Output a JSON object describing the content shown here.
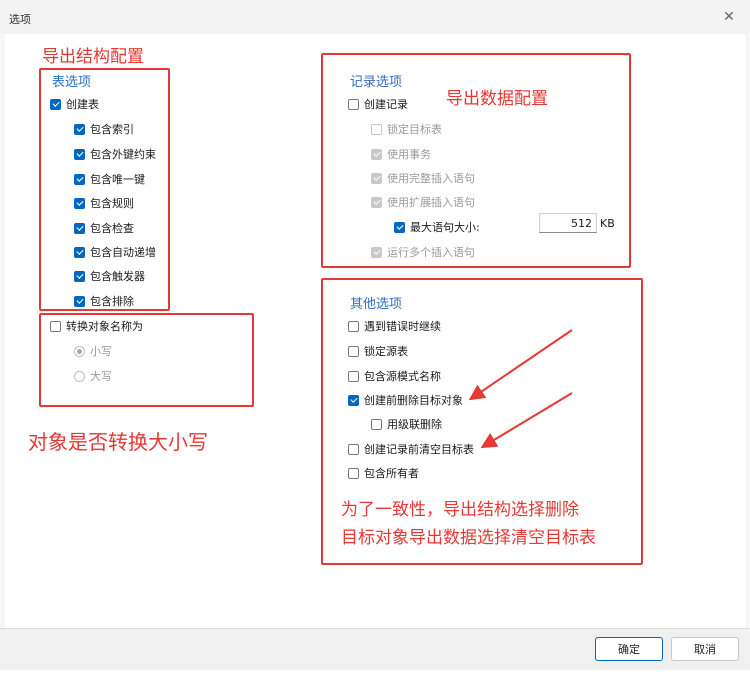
{
  "window": {
    "title": "选项"
  },
  "table_options": {
    "title": "表选项",
    "create_table": "创建表",
    "items": [
      {
        "label": "包含索引"
      },
      {
        "label": "包含外键约束"
      },
      {
        "label": "包含唯一键"
      },
      {
        "label": "包含规则"
      },
      {
        "label": "包含检查"
      },
      {
        "label": "包含自动递增"
      },
      {
        "label": "包含触发器"
      },
      {
        "label": "包含排除"
      }
    ]
  },
  "convert": {
    "label": "转换对象名称为",
    "lower": "小写",
    "upper": "大写"
  },
  "record_options": {
    "title": "记录选项",
    "create_record": "创建记录",
    "lock_target": "锁定目标表",
    "use_transaction": "使用事务",
    "use_complete_insert": "使用完整插入语句",
    "use_extended_insert": "使用扩展插入语句",
    "max_statement": "最大语句大小:",
    "max_value": "512",
    "max_unit": "KB",
    "run_multiple": "运行多个插入语句"
  },
  "other_options": {
    "title": "其他选项",
    "continue_on_error": "遇到错误时继续",
    "lock_source": "锁定源表",
    "include_schema": "包含源模式名称",
    "drop_before_create": "创建前删除目标对象",
    "cascade_drop": "用级联删除",
    "truncate_before_record": "创建记录前清空目标表",
    "include_owner": "包含所有者"
  },
  "annotations": {
    "export_structure": "导出结构配置",
    "export_data": "导出数据配置",
    "case_convert": "对象是否转换大小写",
    "note_line1": "为了一致性，导出结构选择删除",
    "note_line2": "目标对象导出数据选择清空目标表"
  },
  "buttons": {
    "ok": "确定",
    "cancel": "取消"
  },
  "colors": {
    "accent": "#0067c0",
    "group_title": "#2f6fc0",
    "annotation": "#e53935"
  }
}
